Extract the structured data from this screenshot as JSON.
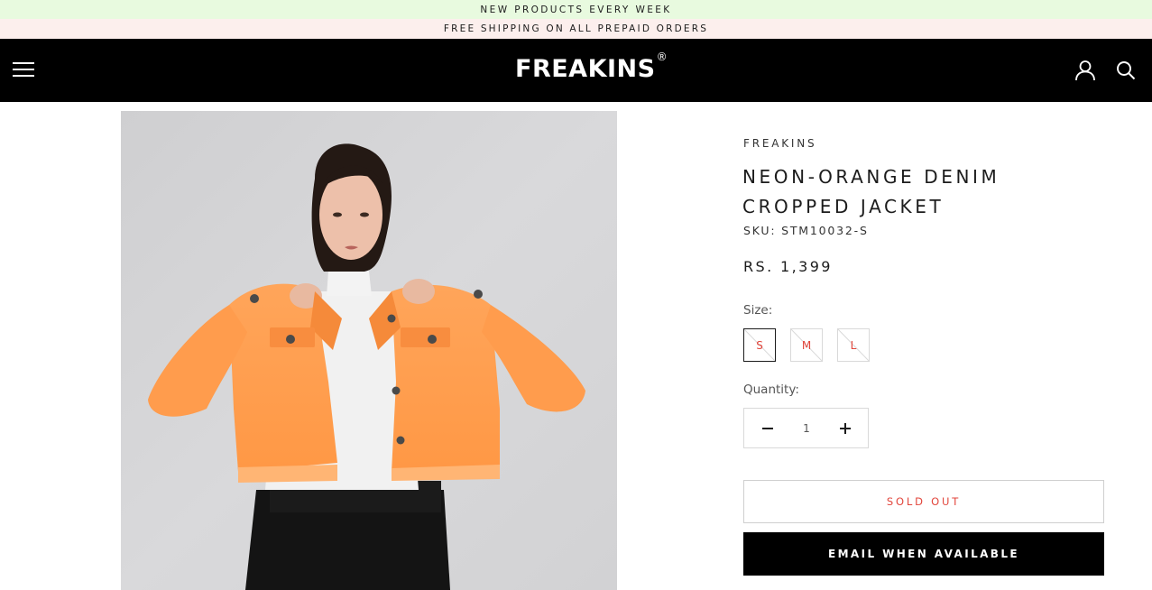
{
  "announcements": {
    "top": "NEW PRODUCTS EVERY WEEK",
    "second": "FREE SHIPPING ON ALL PREPAID ORDERS"
  },
  "header": {
    "logo_text": "FREAKINS",
    "logo_mark": "®",
    "icons": [
      "menu-icon",
      "account-icon",
      "search-icon"
    ]
  },
  "product": {
    "image_description": "model-photo",
    "brand": "FREAKINS",
    "title": "NEON-ORANGE DENIM CROPPED JACKET",
    "sku": "SKU: STM10032-S",
    "price": "RS. 1,399",
    "size_label": "Size:",
    "sizes": [
      {
        "label": "S",
        "selected": true,
        "available": false
      },
      {
        "label": "M",
        "selected": false,
        "available": false
      },
      {
        "label": "L",
        "selected": false,
        "available": false
      }
    ],
    "quantity_label": "Quantity:",
    "quantity": "1",
    "sold_out_label": "SOLD OUT",
    "email_label": "EMAIL WHEN AVAILABLE"
  },
  "colors": {
    "top_banner": "#e8fadf",
    "second_banner": "#fcefed",
    "header": "#000000",
    "accent_red": "#e2463c",
    "jacket": "#ff9f4d"
  }
}
